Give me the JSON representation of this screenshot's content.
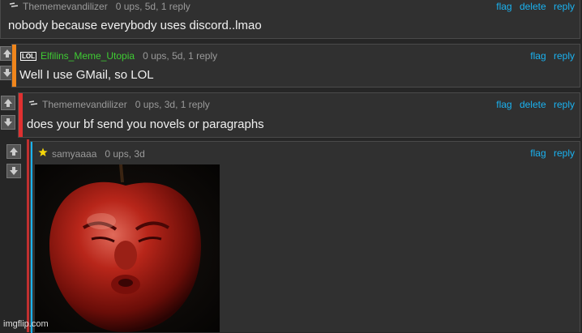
{
  "comments": [
    {
      "username": "Thememevandilizer",
      "meta": "0 ups, 5d, 1 reply",
      "text": "nobody because everybody uses discord..lmao",
      "actions": [
        "flag",
        "delete",
        "reply"
      ],
      "badge": "dash-icon"
    },
    {
      "username": "Elfilins_Meme_Utopia",
      "meta": "0 ups, 5d, 1 reply",
      "text": "Well I use GMail, so LOL",
      "actions": [
        "flag",
        "reply"
      ],
      "badge": "LOL",
      "accent_color": "#f0861c",
      "username_color": "#3fcc33"
    },
    {
      "username": "Thememevandilizer",
      "meta": "0 ups, 3d, 1 reply",
      "text": "does your bf send you novels or paragraphs",
      "actions": [
        "flag",
        "delete",
        "reply"
      ],
      "badge": "dash-icon",
      "accent_color": "#e03030"
    },
    {
      "username": "samyaaaa",
      "meta": "0 ups, 3d",
      "text": "",
      "actions": [
        "flag",
        "reply"
      ],
      "badge": "star-icon",
      "accent_color": "#1ab2f0"
    }
  ],
  "watermark": "imgflip.com",
  "colors": {
    "link": "#1ab2f0",
    "background": "#262626",
    "panel": "#303030"
  }
}
